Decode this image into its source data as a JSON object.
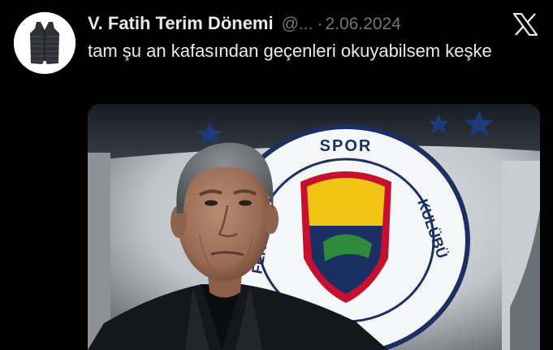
{
  "tweet": {
    "author_name": "V. Fatih Terim Dönemi",
    "handle": "@...",
    "separator": "·",
    "date": "2.06.2024",
    "text": "tam şu an kafasından geçenleri okuyabilsem keşke"
  },
  "icons": {
    "avatar": "padded-vest-icon",
    "brand": "x-logo-icon"
  },
  "media": {
    "emblem_text": "FENERBAHÇE SPOR KULÜBÜ",
    "description_colors": {
      "background": "#000000",
      "text": "#e7e9ea",
      "muted": "#71767b",
      "emblem_yellow": "#f2c515",
      "emblem_navy": "#1c2f63",
      "emblem_green": "#2d8b3a"
    }
  }
}
